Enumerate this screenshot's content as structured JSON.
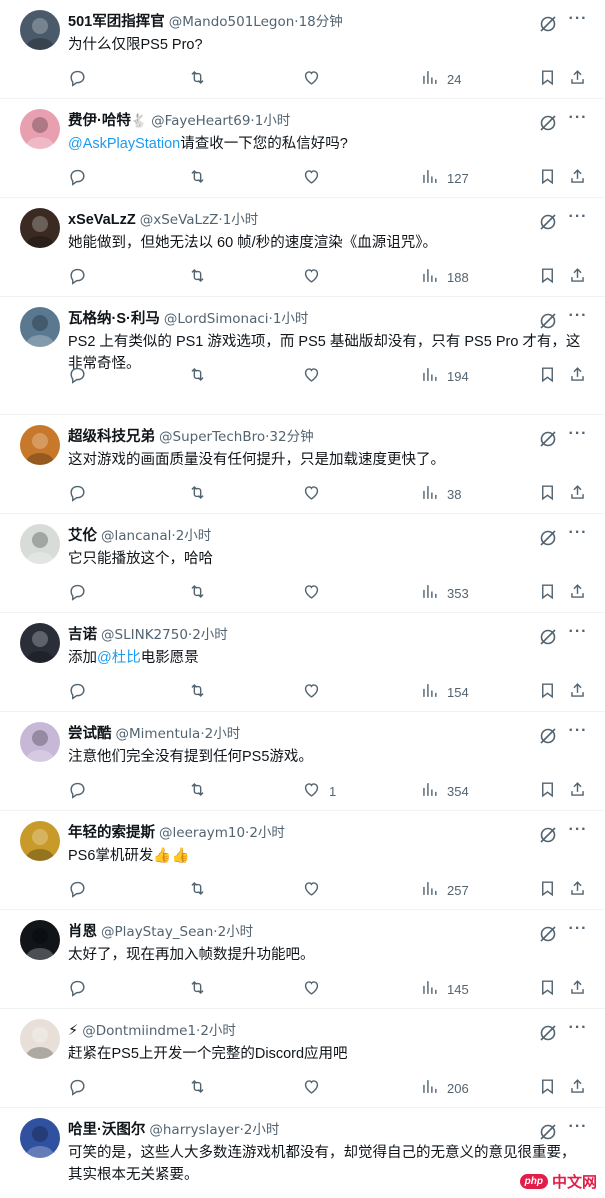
{
  "replies": [
    {
      "name": "501军团指挥官",
      "badge": "",
      "handle": "@Mando501Legon",
      "time": "18分钟",
      "text_parts": [
        {
          "t": "为什么仅限PS5 Pro?",
          "mention": false
        }
      ],
      "replies_count": "",
      "retweets_count": "",
      "likes_count": "",
      "views": "24",
      "avatar_icon": "helmet-soldier-avatar",
      "avatar_color": "#4a5a6a"
    },
    {
      "name": "费伊·哈特",
      "badge": "🐇",
      "handle": "@FayeHeart69",
      "time": "1小时",
      "text_parts": [
        {
          "t": "@AskPlayStation",
          "mention": true
        },
        {
          "t": "请查收一下您的私信好吗?",
          "mention": false
        }
      ],
      "replies_count": "",
      "retweets_count": "",
      "likes_count": "",
      "views": "127",
      "avatar_icon": "pink-anime-avatar",
      "avatar_color": "#e8a0b0"
    },
    {
      "name": "xSeVaLzZ",
      "badge": "",
      "handle": "@xSeVaLzZ",
      "time": "1小时",
      "text_parts": [
        {
          "t": "她能做到，但她无法以 60 帧/秒的速度渲染《血源诅咒》。",
          "mention": false
        }
      ],
      "replies_count": "",
      "retweets_count": "",
      "likes_count": "",
      "views": "188",
      "avatar_icon": "dark-character-avatar",
      "avatar_color": "#3a2a22"
    },
    {
      "name": "瓦格纳·S·利马",
      "badge": "",
      "handle": "@LordSimonaci",
      "time": "1小时",
      "text_parts": [
        {
          "t": "PS2 上有类似的 PS1 游戏选项，而 PS5 基础版却没有，只有 PS5 Pro 才有，这非常奇怪。",
          "mention": false
        }
      ],
      "replies_count": "",
      "retweets_count": "",
      "likes_count": "",
      "views": "194",
      "avatar_icon": "bearded-man-avatar",
      "avatar_color": "#5a7890"
    },
    {
      "name": "超级科技兄弟",
      "badge": "",
      "handle": "@SuperTechBro",
      "time": "32分钟",
      "text_parts": [
        {
          "t": "这对游戏的画面质量没有任何提升，只是加载速度更快了。",
          "mention": false
        }
      ],
      "replies_count": "",
      "retweets_count": "",
      "likes_count": "",
      "views": "38",
      "avatar_icon": "glasses-man-avatar",
      "avatar_color": "#c8782a"
    },
    {
      "name": "艾伦",
      "badge": "",
      "handle": "@lancanal",
      "time": "2小时",
      "text_parts": [
        {
          "t": "它只能播放这个，哈哈",
          "mention": false
        }
      ],
      "replies_count": "",
      "retweets_count": "",
      "likes_count": "",
      "views": "353",
      "avatar_icon": "cartoon-face-avatar",
      "avatar_color": "#d8dcd8"
    },
    {
      "name": "吉诺",
      "badge": "",
      "handle": "@SLINK2750",
      "time": "2小时",
      "text_parts": [
        {
          "t": "添加",
          "mention": false
        },
        {
          "t": "@杜比",
          "mention": true
        },
        {
          "t": "电影愿景",
          "mention": false
        }
      ],
      "replies_count": "",
      "retweets_count": "",
      "likes_count": "",
      "views": "154",
      "avatar_icon": "dark-robot-avatar",
      "avatar_color": "#2a2e38"
    },
    {
      "name": "尝试酷",
      "badge": "",
      "handle": "@Mimentula",
      "time": "2小时",
      "text_parts": [
        {
          "t": "注意他们完全没有提到任何PS5游戏。",
          "mention": false
        }
      ],
      "replies_count": "",
      "retweets_count": "",
      "likes_count": "1",
      "views": "354",
      "avatar_icon": "purple-flower-avatar",
      "avatar_color": "#c8b8d8"
    },
    {
      "name": "年轻的索提斯",
      "badge": "",
      "handle": "@leeraym10",
      "time": "2小时",
      "text_parts": [
        {
          "t": "PS6掌机研发👍👍",
          "mention": false
        }
      ],
      "replies_count": "",
      "retweets_count": "",
      "likes_count": "",
      "views": "257",
      "avatar_icon": "gold-statue-avatar",
      "avatar_color": "#c89a2a"
    },
    {
      "name": "肖恩",
      "badge": "",
      "handle": "@PlayStay_Sean",
      "time": "2小时",
      "text_parts": [
        {
          "t": "太好了，现在再加入帧数提升功能吧。",
          "mention": false
        }
      ],
      "replies_count": "",
      "retweets_count": "",
      "likes_count": "",
      "views": "145",
      "avatar_icon": "playstation-logo-avatar",
      "avatar_color": "#111418"
    },
    {
      "name": "⚡",
      "badge": "",
      "handle": "@Dontmiindme1",
      "time": "2小时",
      "text_parts": [
        {
          "t": "赶紧在PS5上开发一个完整的Discord应用吧",
          "mention": false
        }
      ],
      "replies_count": "",
      "retweets_count": "",
      "likes_count": "",
      "views": "206",
      "avatar_icon": "cartoon-boy-avatar",
      "avatar_color": "#e8e0d8"
    },
    {
      "name": "哈里·沃图尔",
      "badge": "",
      "handle": "@harryslayer",
      "time": "2小时",
      "text_parts": [
        {
          "t": "可笑的是，这些人大多数连游戏机都没有，却觉得自己的无意义的意见很重要，其实根本无关紧要。",
          "mention": false
        }
      ],
      "replies_count": "",
      "retweets_count": "",
      "likes_count": "",
      "views": "",
      "avatar_icon": "spiderman-avatar",
      "avatar_color": "#3050a0"
    }
  ],
  "separator": "·",
  "more_label": "···",
  "watermark": {
    "logo": "php",
    "text": "中文网"
  },
  "colors": {
    "accent": "#1d9bf0",
    "muted": "#536471",
    "text": "#0f1419"
  }
}
